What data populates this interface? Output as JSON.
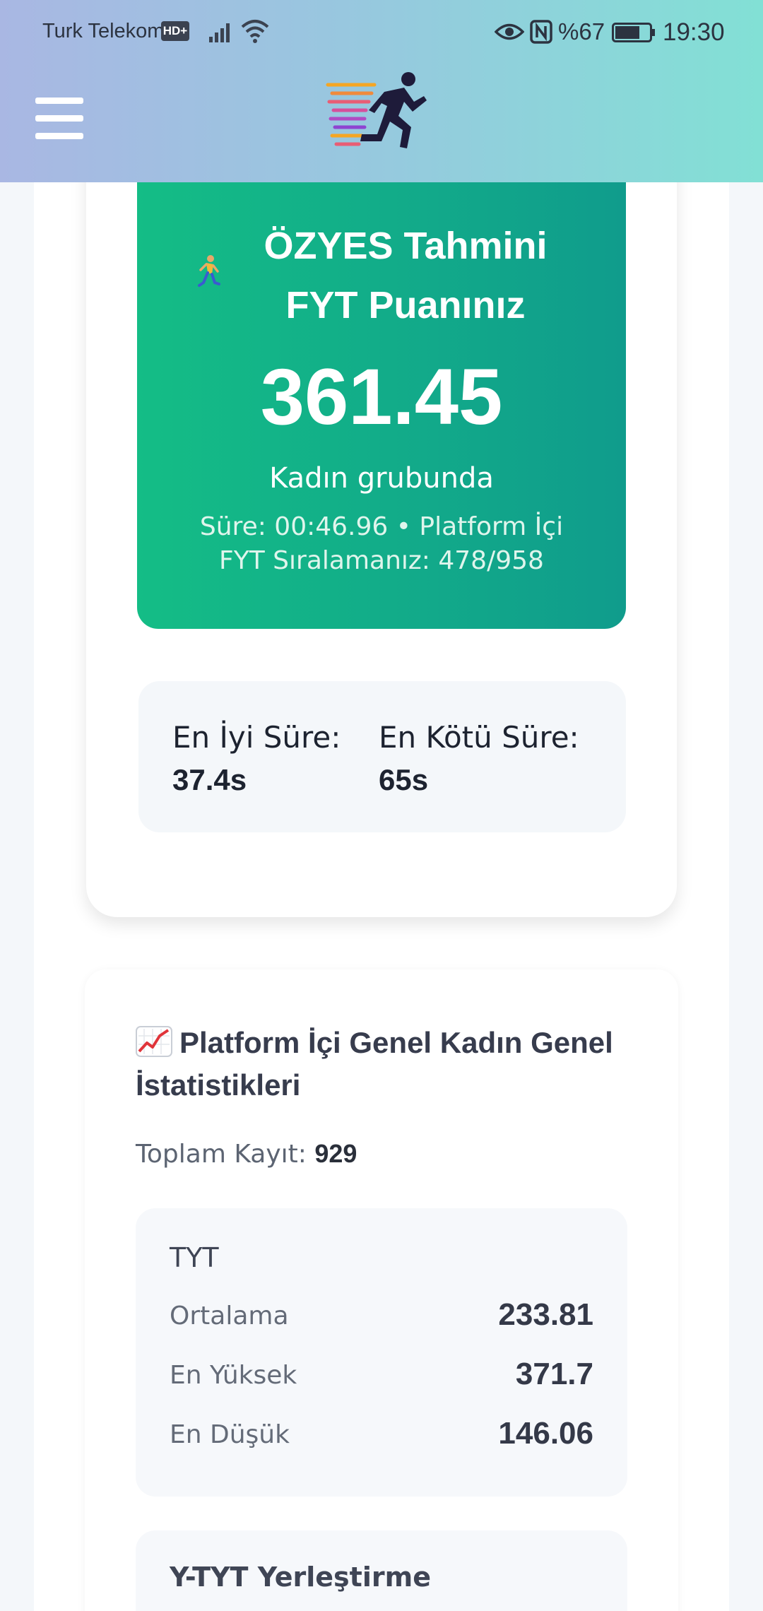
{
  "status_bar": {
    "carrier": "Turk Telekom",
    "hd_badge": "HD+",
    "battery_percent": "%67",
    "time": "19:30"
  },
  "header": {
    "menu_icon": "hamburger-menu-icon",
    "logo_icon": "running-man-logo"
  },
  "score_card": {
    "emoji": "runner-emoji",
    "title": "ÖZYES Tahmini FYT Puanınız",
    "score": "361.45",
    "group": "Kadın grubunda",
    "detail": "Süre: 00:46.96 • Platform İçi FYT Sıralamanız: 478/958"
  },
  "times": {
    "best_label": "En İyi Süre:",
    "best_value": "37.4s",
    "worst_label": "En Kötü Süre:",
    "worst_value": "65s"
  },
  "stats": {
    "emoji": "chart-increasing-emoji",
    "title": "Platform İçi Genel Kadın Genel İstatistikleri",
    "total_label": "Toplam Kayıt:",
    "total_value": "929",
    "tyt": {
      "title": "TYT",
      "rows": [
        {
          "label": "Ortalama",
          "value": "233.81"
        },
        {
          "label": "En Yüksek",
          "value": "371.7"
        },
        {
          "label": "En Düşük",
          "value": "146.06"
        }
      ]
    },
    "ytyt": {
      "title": "Y-TYT Yerleştirme"
    }
  },
  "colors": {
    "header_gradient": [
      "#a9b7e3",
      "#82e0d5"
    ],
    "score_gradient": [
      "#14bd86",
      "#109c8c"
    ]
  }
}
